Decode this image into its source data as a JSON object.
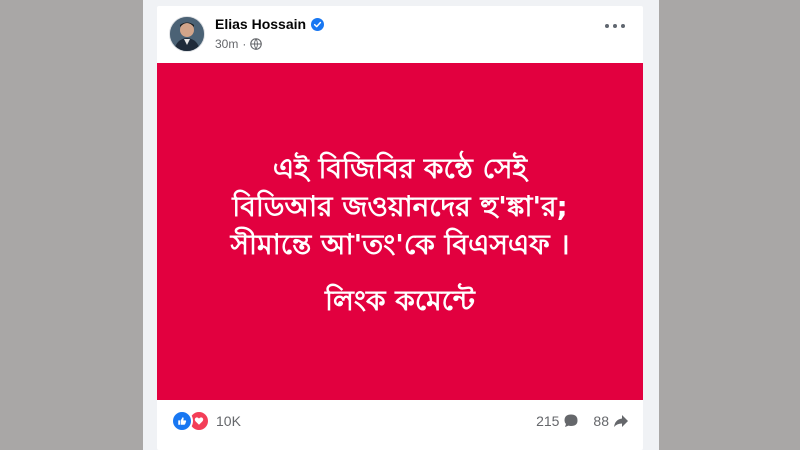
{
  "post": {
    "author": "Elias Hossain",
    "time": "30m",
    "headline_lines": [
      "এই বিজিবির কন্ঠে সেই",
      "বিডিআর জওয়ানদের হু'ঙ্কা'র;",
      "সীমান্তে আ'তং'কে বিএসএফ ।"
    ],
    "cta": "লিংক কমেন্টে",
    "image_bg": "#e2003f"
  },
  "stats": {
    "reactions": "10K",
    "comments": "215",
    "shares": "88"
  },
  "icons": [
    "verified-badge-icon",
    "globe-icon",
    "more-options-icon",
    "like-icon",
    "love-icon",
    "comment-icon",
    "share-icon"
  ]
}
